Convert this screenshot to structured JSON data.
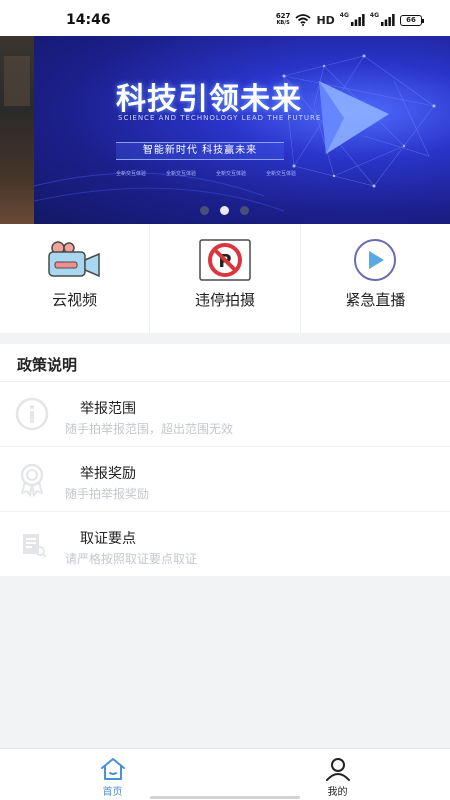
{
  "status_bar": {
    "time": "14:46",
    "net_speed_value": "627",
    "net_speed_unit": "KB/S",
    "hd_label": "HD",
    "signal_1": "4G",
    "signal_2": "4G",
    "battery": "66"
  },
  "banner": {
    "title": "科技引领未来",
    "subtitle": "SCIENCE AND TECHNOLOGY LEAD THE FUTURE",
    "slogan": "智能新时代  科技赢未来",
    "tags": [
      "全新交互体验",
      "全新交互体验",
      "全新交互体验",
      "全新交互体验"
    ],
    "page_count": 3,
    "active_page": 2
  },
  "quick_actions": [
    {
      "label": "云视频",
      "icon": "camera-icon"
    },
    {
      "label": "违停拍摄",
      "icon": "no-parking-icon"
    },
    {
      "label": "紧急直播",
      "icon": "play-icon"
    }
  ],
  "policy": {
    "title": "政策说明",
    "items": [
      {
        "name": "举报范围",
        "desc": "随手拍举报范围，超出范围无效",
        "icon": "info-icon"
      },
      {
        "name": "举报奖励",
        "desc": "随手拍举报奖励",
        "icon": "award-icon"
      },
      {
        "name": "取证要点",
        "desc": "请严格按照取证要点取证",
        "icon": "document-icon"
      }
    ]
  },
  "bottom_nav": [
    {
      "label": "首页",
      "icon": "home-icon",
      "active": true
    },
    {
      "label": "我的",
      "icon": "user-icon",
      "active": false
    }
  ],
  "colors": {
    "accent": "#4a90d9",
    "banner_bg": "#1b1f8a",
    "page_bg": "#f2f3f5"
  }
}
